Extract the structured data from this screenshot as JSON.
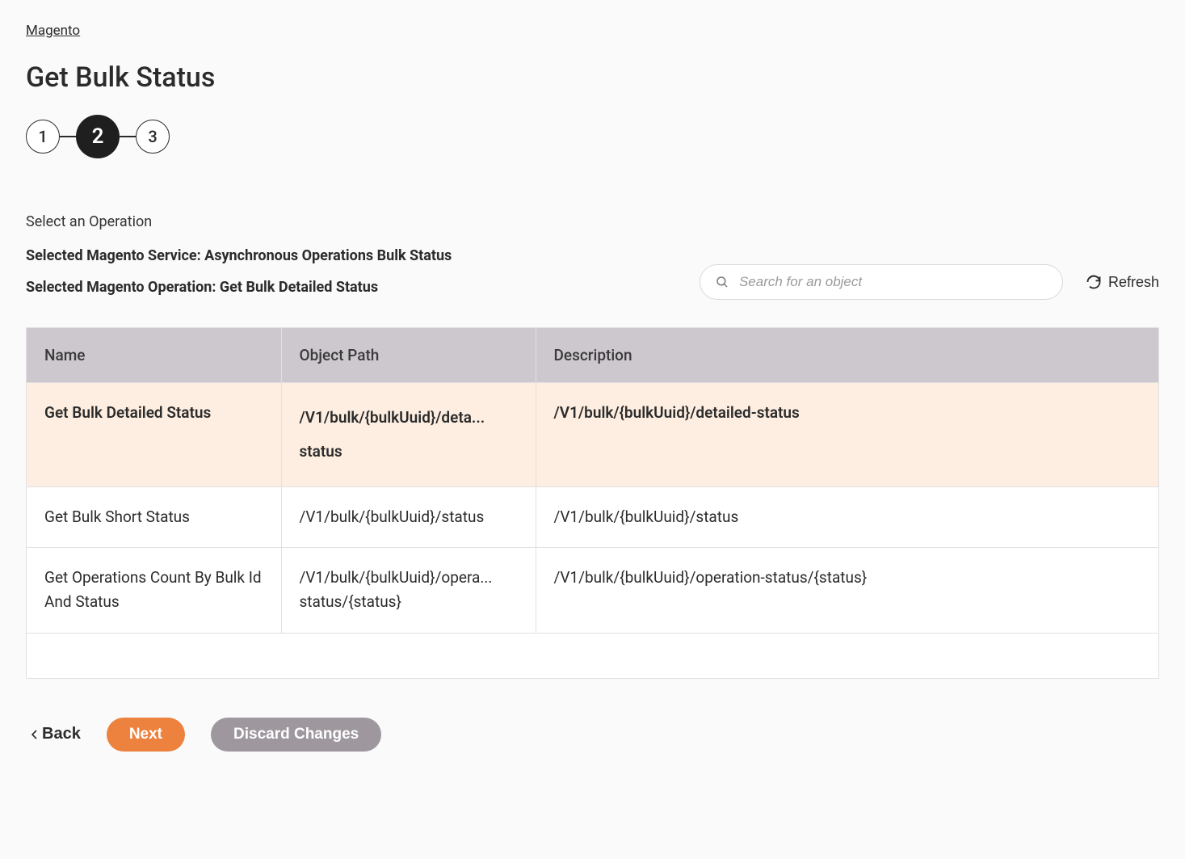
{
  "breadcrumb": {
    "label": "Magento"
  },
  "page_title": "Get Bulk Status",
  "stepper": {
    "steps": [
      "1",
      "2",
      "3"
    ],
    "active_index": 1
  },
  "section_label": "Select an Operation",
  "selected_service_line": "Selected Magento Service: Asynchronous Operations Bulk Status",
  "selected_operation_line": "Selected Magento Operation: Get Bulk Detailed Status",
  "search": {
    "placeholder": "Search for an object"
  },
  "refresh_label": "Refresh",
  "table": {
    "headers": {
      "name": "Name",
      "path": "Object Path",
      "desc": "Description"
    },
    "rows": [
      {
        "name": "Get Bulk Detailed Status",
        "path_line1": "/V1/bulk/{bulkUuid}/deta...",
        "path_line2": "status",
        "desc": "/V1/bulk/{bulkUuid}/detailed-status",
        "selected": true
      },
      {
        "name": "Get Bulk Short Status",
        "path_line1": "/V1/bulk/{bulkUuid}/status",
        "path_line2": "",
        "desc": "/V1/bulk/{bulkUuid}/status",
        "selected": false
      },
      {
        "name": "Get Operations Count By Bulk Id And Status",
        "path_line1": "/V1/bulk/{bulkUuid}/opera...",
        "path_line2": "status/{status}",
        "desc": "/V1/bulk/{bulkUuid}/operation-status/{status}",
        "selected": false
      }
    ]
  },
  "buttons": {
    "back": "Back",
    "next": "Next",
    "discard": "Discard Changes"
  }
}
